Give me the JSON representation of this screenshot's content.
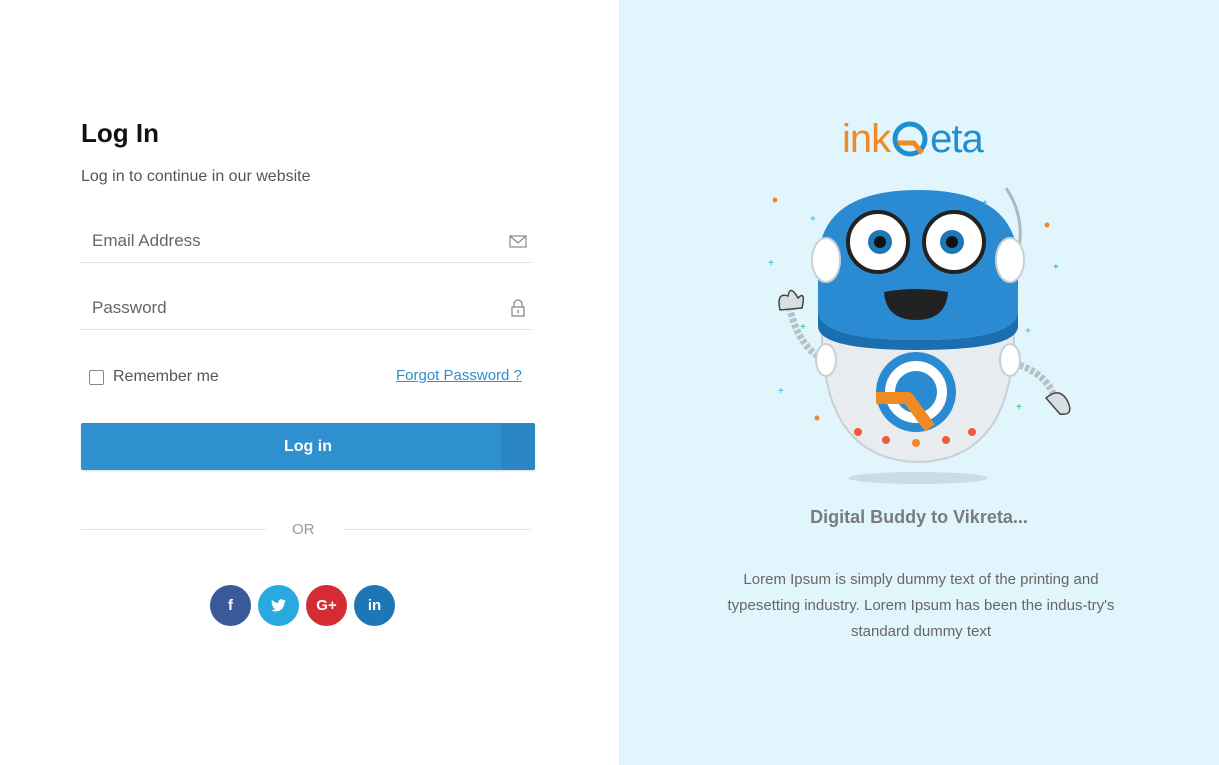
{
  "login": {
    "title": "Log In",
    "subtitle": "Log in to continue in our website",
    "email_placeholder": "Email Address",
    "password_placeholder": "Password",
    "remember_label": "Remember me",
    "forgot_label": "Forgot Password ?",
    "submit_label": "Log in",
    "or_label": "OR",
    "social": [
      {
        "icon": "facebook-icon",
        "glyph": "f",
        "color": "#3b5998"
      },
      {
        "icon": "twitter-icon",
        "glyph": "t",
        "color": "#28aae1"
      },
      {
        "icon": "google-plus-icon",
        "glyph": "G+",
        "color": "#d52b35"
      },
      {
        "icon": "linkedin-icon",
        "glyph": "in",
        "color": "#1d77b5"
      }
    ]
  },
  "promo": {
    "logo_part1": "ink",
    "logo_part2": "eta",
    "tagline": "Digital Buddy to Vikreta...",
    "description": "Lorem Ipsum is simply dummy text of the printing and typesetting industry. Lorem Ipsum has been the indus-try's standard dummy text"
  },
  "colors": {
    "accent": "#2f90cf",
    "right_panel_bg": "#e1f5fd",
    "brand_orange": "#f08a24",
    "brand_blue": "#1f8fd0"
  }
}
